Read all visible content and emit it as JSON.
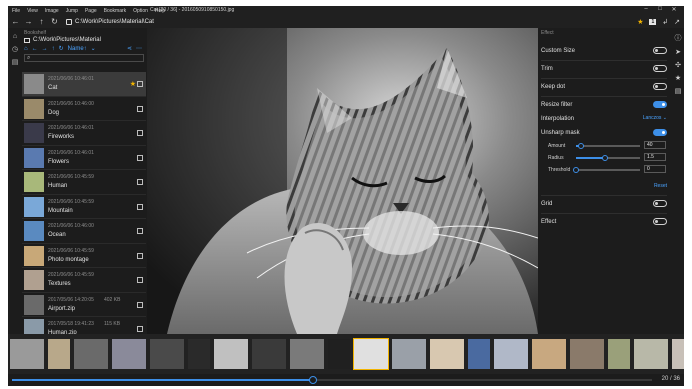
{
  "window": {
    "title": "Cat [20 / 36] - 2016050910850150.jpg",
    "controls": [
      "–",
      "□",
      "✕"
    ]
  },
  "menu": [
    "File",
    "View",
    "Image",
    "Jump",
    "Page",
    "Bookmark",
    "Option",
    "Help"
  ],
  "toolbar": {
    "address": "C:\\Work\\Pictures\\Material\\Cat",
    "one_page": "1"
  },
  "bookshelf": {
    "label": "Bookshelf",
    "path": "C:\\Work\\Pictures\\Material",
    "sort_label": "Name↑",
    "search_placeholder": "",
    "items": [
      {
        "date": "2021/06/06 10:46:01",
        "size": "",
        "name": "Cat",
        "selected": true,
        "favorite": true
      },
      {
        "date": "2021/06/06 10:46:00",
        "size": "",
        "name": "Dog",
        "selected": false,
        "favorite": false
      },
      {
        "date": "2021/06/06 10:46:01",
        "size": "",
        "name": "Fireworks",
        "selected": false,
        "favorite": false
      },
      {
        "date": "2021/06/06 10:46:01",
        "size": "",
        "name": "Flowers",
        "selected": false,
        "favorite": false
      },
      {
        "date": "2021/06/06 10:45:59",
        "size": "",
        "name": "Human",
        "selected": false,
        "favorite": false
      },
      {
        "date": "2021/06/06 10:45:59",
        "size": "",
        "name": "Mountain",
        "selected": false,
        "favorite": false
      },
      {
        "date": "2021/06/06 10:46:00",
        "size": "",
        "name": "Ocean",
        "selected": false,
        "favorite": false
      },
      {
        "date": "2021/06/06 10:45:59",
        "size": "",
        "name": "Photo montage",
        "selected": false,
        "favorite": false
      },
      {
        "date": "2021/06/06 10:45:59",
        "size": "",
        "name": "Textures",
        "selected": false,
        "favorite": false
      },
      {
        "date": "2017/05/06 14:20:05",
        "size": "402 KB",
        "name": "Airport.zip",
        "selected": false,
        "favorite": false
      },
      {
        "date": "2017/05/18 19:41:23",
        "size": "115 KB",
        "name": "Human.zip",
        "selected": false,
        "favorite": false
      }
    ]
  },
  "effect": {
    "title": "Effect",
    "custom_size": "Custom Size",
    "trim": "Trim",
    "keep_dot": "Keep dot",
    "resize_filter": "Resize filter",
    "interpolation": "Interpolation",
    "interpolation_value": "Lanczos",
    "unsharp_mask": "Unsharp mask",
    "amount_label": "Amount",
    "amount_value": "40",
    "radius_label": "Radius",
    "radius_value": "1.5",
    "threshold_label": "Threshold",
    "threshold_value": "0",
    "reset": "Reset",
    "grid": "Grid",
    "effect": "Effect",
    "amount_fraction": 0.08,
    "radius_fraction": 0.45,
    "threshold_fraction": 0.0,
    "toggles": {
      "custom_size": false,
      "trim": false,
      "keep_dot": false,
      "resize_filter": true,
      "unsharp_mask": true,
      "grid": false,
      "effect": false
    }
  },
  "page": {
    "current": 20,
    "total": 36,
    "label": "20 / 36",
    "progress": 0.47
  },
  "colors": {
    "accent": "#3d8fe8",
    "favorite": "#f2b400",
    "background": "#1c1c1c"
  }
}
